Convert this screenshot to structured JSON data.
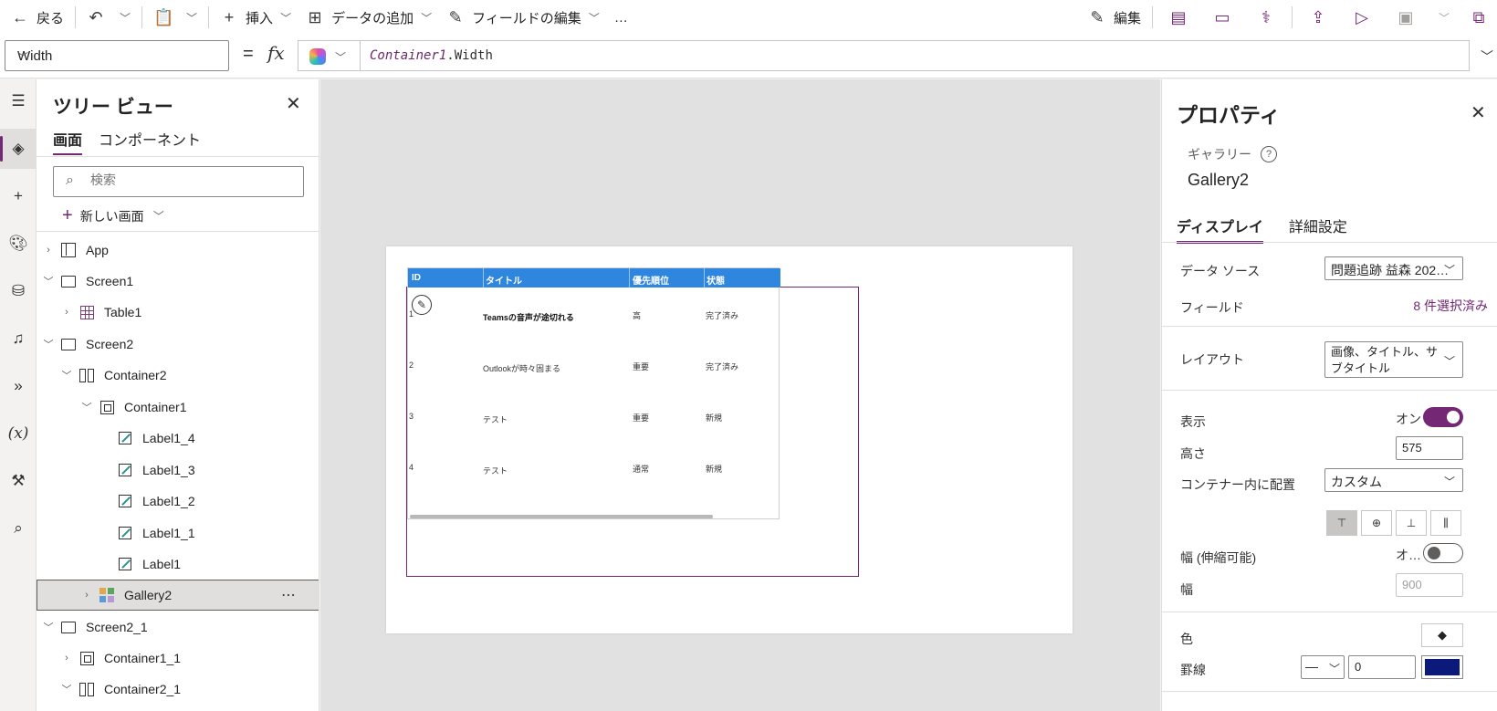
{
  "toolbar": {
    "back_label": "戻る",
    "insert_label": "挿入",
    "add_data_label": "データの追加",
    "edit_fields_label": "フィールドの編集",
    "more_label": "…",
    "edit_label": "編集"
  },
  "formula_bar": {
    "property": "Width",
    "equals": "=",
    "fx": "fx",
    "formula_object": "Container1",
    "formula_member": ".Width"
  },
  "tree": {
    "title": "ツリー ビュー",
    "tabs": [
      "画面",
      "コンポーネント"
    ],
    "search_placeholder": "検索",
    "new_screen_label": "新しい画面",
    "nodes": [
      {
        "label": "App",
        "icon": "app-icon"
      },
      {
        "label": "Screen1",
        "icon": "screen-icon"
      },
      {
        "label": "Table1",
        "icon": "table-icon"
      },
      {
        "label": "Screen2",
        "icon": "screen-icon"
      },
      {
        "label": "Container2",
        "icon": "horizontal-container-icon"
      },
      {
        "label": "Container1",
        "icon": "container-icon"
      },
      {
        "label": "Label1_4",
        "icon": "label-icon"
      },
      {
        "label": "Label1_3",
        "icon": "label-icon"
      },
      {
        "label": "Label1_2",
        "icon": "label-icon"
      },
      {
        "label": "Label1_1",
        "icon": "label-icon"
      },
      {
        "label": "Label1",
        "icon": "label-icon"
      },
      {
        "label": "Gallery2",
        "icon": "gallery-icon"
      },
      {
        "label": "Screen2_1",
        "icon": "screen-icon"
      },
      {
        "label": "Container1_1",
        "icon": "container-icon"
      },
      {
        "label": "Container2_1",
        "icon": "horizontal-container-icon"
      }
    ]
  },
  "canvas": {
    "table": {
      "columns": [
        "ID",
        "タイトル",
        "優先順位",
        "状態"
      ],
      "rows": [
        {
          "id": "1",
          "title": "Teamsの音声が途切れる",
          "priority": "高",
          "status": "完了済み"
        },
        {
          "id": "2",
          "title": "Outlookが時々固まる",
          "priority": "重要",
          "status": "完了済み"
        },
        {
          "id": "3",
          "title": "テスト",
          "priority": "重要",
          "status": "新規"
        },
        {
          "id": "4",
          "title": "テスト",
          "priority": "通常",
          "status": "新規"
        }
      ]
    }
  },
  "properties": {
    "title": "プロパティ",
    "control_type": "ギャラリー",
    "control_name": "Gallery2",
    "tabs": [
      "ディスプレイ",
      "詳細設定"
    ],
    "data_source_label": "データ ソース",
    "data_source_value": "問題追跡 益森 202…",
    "fields_label": "フィールド",
    "fields_value": "8 件選択済み",
    "layout_label": "レイアウト",
    "layout_value": "画像、タイトル、サブタイトル",
    "visible_label": "表示",
    "visible_value": "オン",
    "height_label": "高さ",
    "height_value": "575",
    "align_label": "コンテナー内に配置",
    "align_value": "カスタム",
    "flex_width_label": "幅 (伸縮可能)",
    "flex_width_value": "オ…",
    "width_label": "幅",
    "width_value": "900",
    "color_label": "色",
    "border_label": "罫線",
    "border_width_value": "0",
    "border_color": "#0b1a7a"
  }
}
